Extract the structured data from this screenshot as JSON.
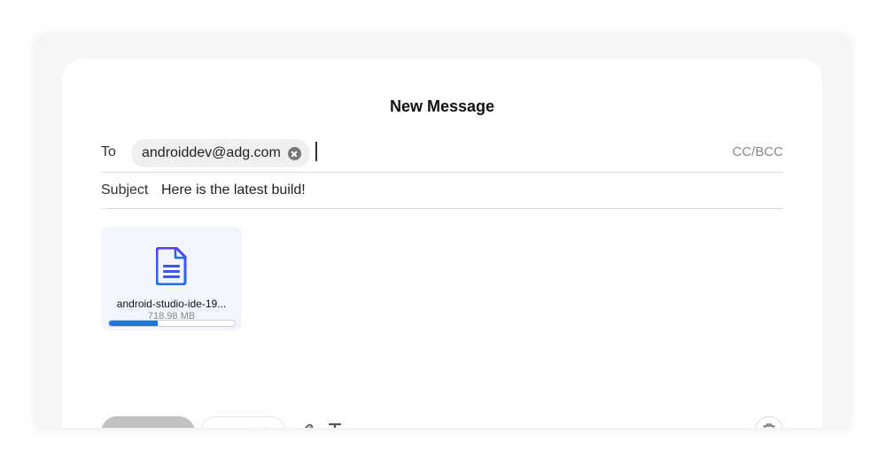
{
  "dialog": {
    "title": "New Message"
  },
  "to": {
    "label": "To",
    "recipients": [
      {
        "email": "androiddev@adg.com"
      }
    ],
    "cc_bcc_label": "CC/BCC"
  },
  "subject": {
    "label": "Subject",
    "value": "Here is the latest build!"
  },
  "attachment": {
    "icon": "document-icon",
    "name": "android-studio-ide-19...",
    "size": "718.98 MB",
    "upload_progress_percent": 39
  },
  "toolbar": {
    "send_label": "",
    "save_draft_label": "Save draft",
    "attach_icon": "paperclip-icon",
    "format_icon": "text-format-icon",
    "delete_icon": "trash-icon"
  },
  "colors": {
    "accent": "#1a73e8",
    "doc_icon_top": "#5b3df5",
    "doc_icon_bottom": "#1f6fe8",
    "attachment_bg": "#f2f6fc"
  }
}
